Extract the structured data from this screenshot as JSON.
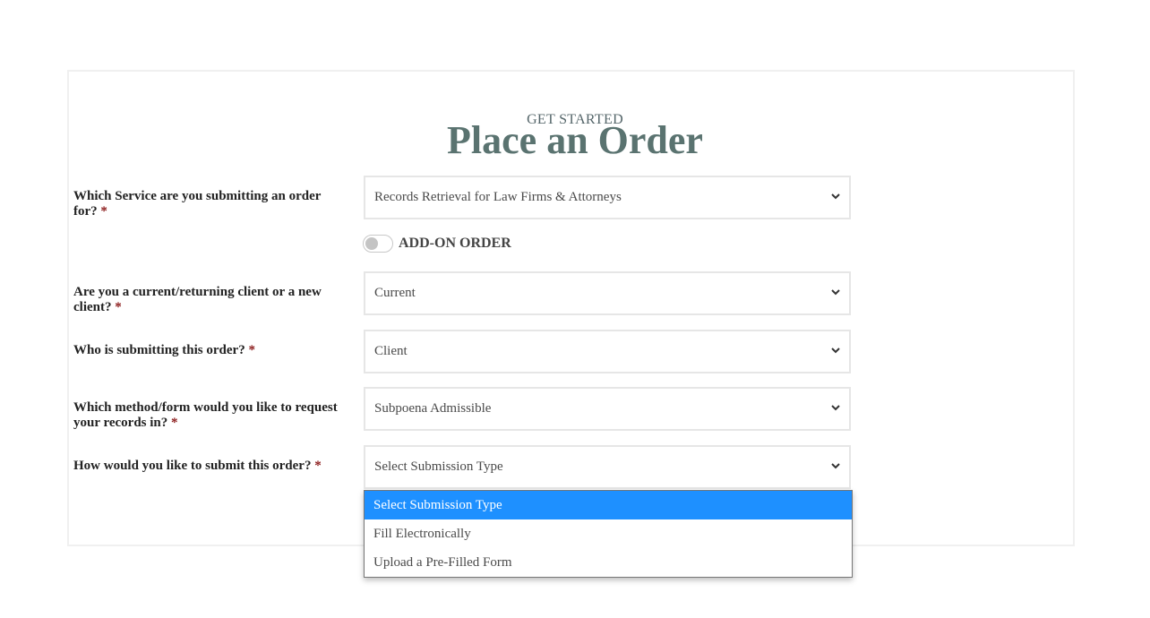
{
  "header": {
    "eyebrow": "GET STARTED",
    "title": "Place an Order"
  },
  "required_mark": "*",
  "questions": [
    {
      "label": "Which Service are you submitting an order for?",
      "value": "Records Retrieval for Law Firms & Attorneys"
    },
    {
      "label": "Are you a current/returning client or a new client?",
      "value": "Current"
    },
    {
      "label": "Who is submitting this order?",
      "value": "Client"
    },
    {
      "label": "Which method/form would you like to request your records in?",
      "value": "Subpoena Admissible"
    },
    {
      "label": "How would you like to submit this order?",
      "value": "Select Submission Type"
    }
  ],
  "addon": {
    "label": "ADD-ON ORDER",
    "enabled": false
  },
  "submission_dropdown": {
    "options": [
      "Select Submission Type",
      "Fill Electronically",
      "Upload a Pre-Filled Form"
    ],
    "highlighted_index": 0
  },
  "colors": {
    "title": "#5a7370",
    "required": "#8b1a1a",
    "highlight": "#1e90ff"
  },
  "icons": {
    "select_arrow": "chevron-down-icon"
  }
}
